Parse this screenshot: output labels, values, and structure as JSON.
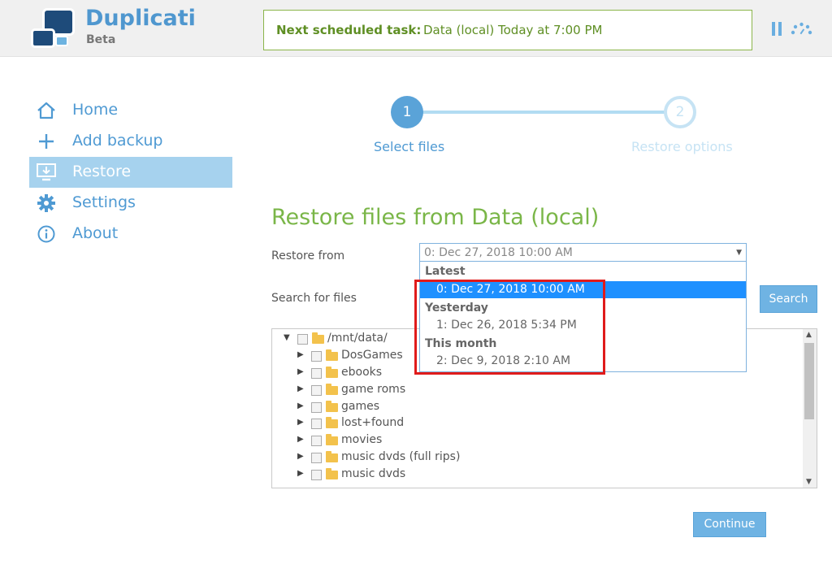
{
  "header": {
    "brand": "Duplicati",
    "subtitle": "Beta",
    "schedule_label": "Next scheduled task:",
    "schedule_value": "Data (local) Today at 7:00 PM"
  },
  "sidebar": {
    "items": [
      {
        "label": "Home",
        "icon": "home-icon"
      },
      {
        "label": "Add backup",
        "icon": "plus-icon"
      },
      {
        "label": "Restore",
        "icon": "restore-icon",
        "active": true
      },
      {
        "label": "Settings",
        "icon": "gear-icon"
      },
      {
        "label": "About",
        "icon": "info-icon"
      }
    ]
  },
  "steps": [
    {
      "number": "1",
      "label": "Select files",
      "active": true
    },
    {
      "number": "2",
      "label": "Restore options",
      "active": false
    }
  ],
  "main": {
    "title": "Restore files from Data (local)",
    "restore_from_label": "Restore from",
    "search_label": "Search for files",
    "search_button": "Search",
    "continue_button": "Continue",
    "select_value": "0: Dec 27, 2018 10:00 AM",
    "dropdown": {
      "groups": [
        {
          "label": "Latest",
          "options": [
            {
              "label": "0: Dec 27, 2018 10:00 AM",
              "selected": true
            }
          ]
        },
        {
          "label": "Yesterday",
          "options": [
            {
              "label": "1: Dec 26, 2018 5:34 PM",
              "selected": false
            }
          ]
        },
        {
          "label": "This month",
          "options": [
            {
              "label": "2: Dec 9, 2018 2:10 AM",
              "selected": false
            }
          ]
        }
      ]
    },
    "tree": {
      "root": "/mnt/data/",
      "children": [
        "DosGames",
        "ebooks",
        "game roms",
        "games",
        "lost+found",
        "movies",
        "music dvds (full rips)",
        "music dvds"
      ]
    }
  },
  "colors": {
    "accent_blue": "#4f9ad3",
    "title_green": "#7ab648",
    "selected_option": "#1e90ff",
    "highlight_red": "#e01b1b"
  }
}
